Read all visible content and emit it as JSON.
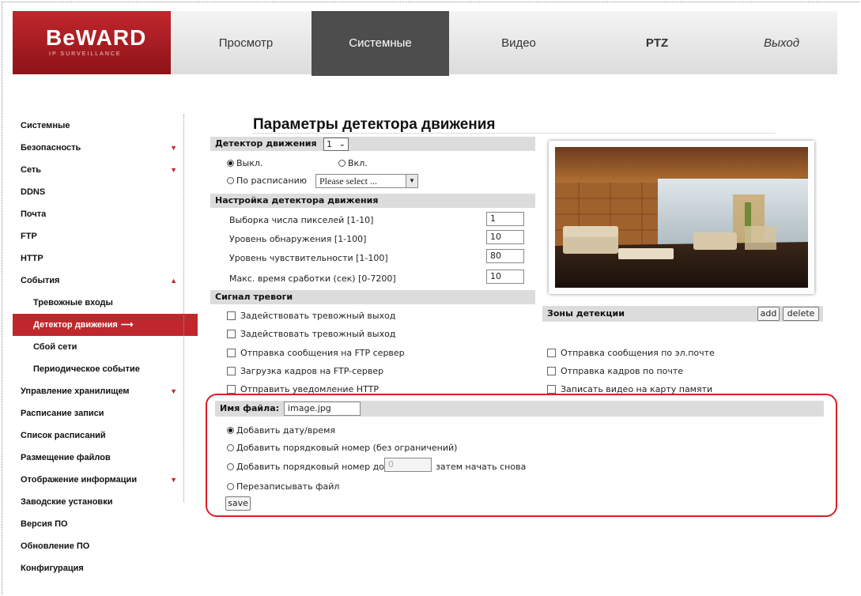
{
  "header": {
    "logo_text": "BeWARD",
    "logo_sub": "IP SURVEILLANCE",
    "nav": [
      {
        "label": "Просмотр"
      },
      {
        "label": "Системные"
      },
      {
        "label": "Видео"
      },
      {
        "label": "PTZ"
      },
      {
        "label": "Выход"
      }
    ]
  },
  "sidebar": {
    "items": [
      {
        "label": "Системные"
      },
      {
        "label": "Безопасность"
      },
      {
        "label": "Сеть"
      },
      {
        "label": "DDNS"
      },
      {
        "label": "Почта"
      },
      {
        "label": "FTP"
      },
      {
        "label": "HTTP"
      },
      {
        "label": "События"
      },
      {
        "label": "Тревожные входы"
      },
      {
        "label": "Детектор движения"
      },
      {
        "label": "Сбой сети"
      },
      {
        "label": "Периодическое событие"
      },
      {
        "label": "Управление хранилищем"
      },
      {
        "label": "Расписание записи"
      },
      {
        "label": "Список расписаний"
      },
      {
        "label": "Размещение файлов"
      },
      {
        "label": "Отображение информации"
      },
      {
        "label": "Заводские установки"
      },
      {
        "label": "Версия ПО"
      },
      {
        "label": "Обновление ПО"
      },
      {
        "label": "Конфигурация"
      }
    ]
  },
  "main": {
    "title": "Параметры детектора движения",
    "detector": {
      "label": "Детектор движения",
      "value": "1",
      "off_label": "Выкл.",
      "on_label": "Вкл.",
      "schedule_label": "По расписанию",
      "schedule_value": "Please select ..."
    },
    "settings": {
      "header": "Настройка детектора движения",
      "rows": [
        {
          "label": "Выборка числа пикселей [1-10]",
          "value": "1"
        },
        {
          "label": "Уровень обнаружения [1-100]",
          "value": "10"
        },
        {
          "label": "Уровень чувствительности [1-100]",
          "value": "80"
        },
        {
          "label": "Макс. время сработки (сек) [0-7200]",
          "value": "10"
        }
      ]
    },
    "alarm": {
      "header": "Сигнал тревоги",
      "out1": "Задействовать тревожный выход",
      "out2": "Задействовать тревожный выход",
      "ftp_msg": "Отправка сообщения на FTP сервер",
      "ftp_upload": "Загрузка кадров на FTP-сервер",
      "http_notify": "Отправить уведомление HTTP",
      "email_msg": "Отправка сообщения по эл.почте",
      "email_frames": "Отправка кадров по почте",
      "record_sd": "Записать видео на карту памяти"
    },
    "zones": {
      "label": "Зоны детекции",
      "add": "add",
      "delete": "delete"
    },
    "file": {
      "label": "Имя файла:",
      "value": "image.jpg",
      "opt_datetime": "Добавить дату/время",
      "opt_seq_unlim": "Добавить порядковый номер (без ограничений)",
      "opt_seq_to": "Добавить порядковый номер до",
      "seq_placeholder": "0",
      "opt_seq_after": "затем начать снова",
      "opt_overwrite": "Перезаписывать файл",
      "save": "save"
    }
  }
}
